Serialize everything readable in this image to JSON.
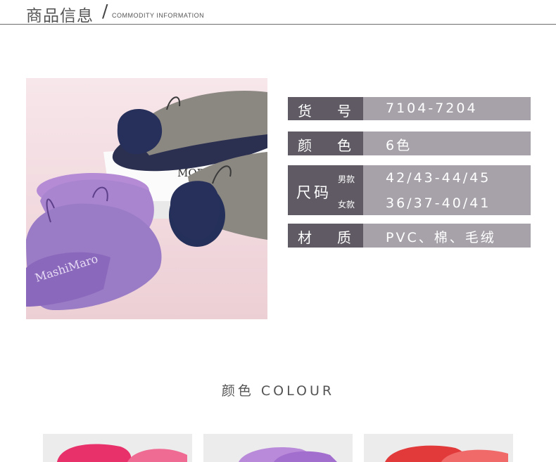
{
  "header": {
    "title_cn": "商品信息",
    "slash": "/",
    "title_en": "COMMODITY INFORMATION"
  },
  "product_photo": {
    "box_text": "MORA",
    "embroidery_text": "MashiMaro"
  },
  "specs": {
    "item_no": {
      "label_a": "货",
      "label_b": "号",
      "value": "7104-7204"
    },
    "color": {
      "label_a": "颜",
      "label_b": "色",
      "value": "6色"
    },
    "size": {
      "label": "尺码",
      "men_label": "男款",
      "men_value": "42/43-44/45",
      "women_label": "女款",
      "women_value": "36/37-40/41"
    },
    "material": {
      "label_a": "材",
      "label_b": "质",
      "value": "PVC、棉、毛绒"
    }
  },
  "colour_section": {
    "title": "颜色  COLOUR"
  },
  "colors": {
    "label_bg": "#5f5a63",
    "value_bg": "#a7a2aa"
  }
}
